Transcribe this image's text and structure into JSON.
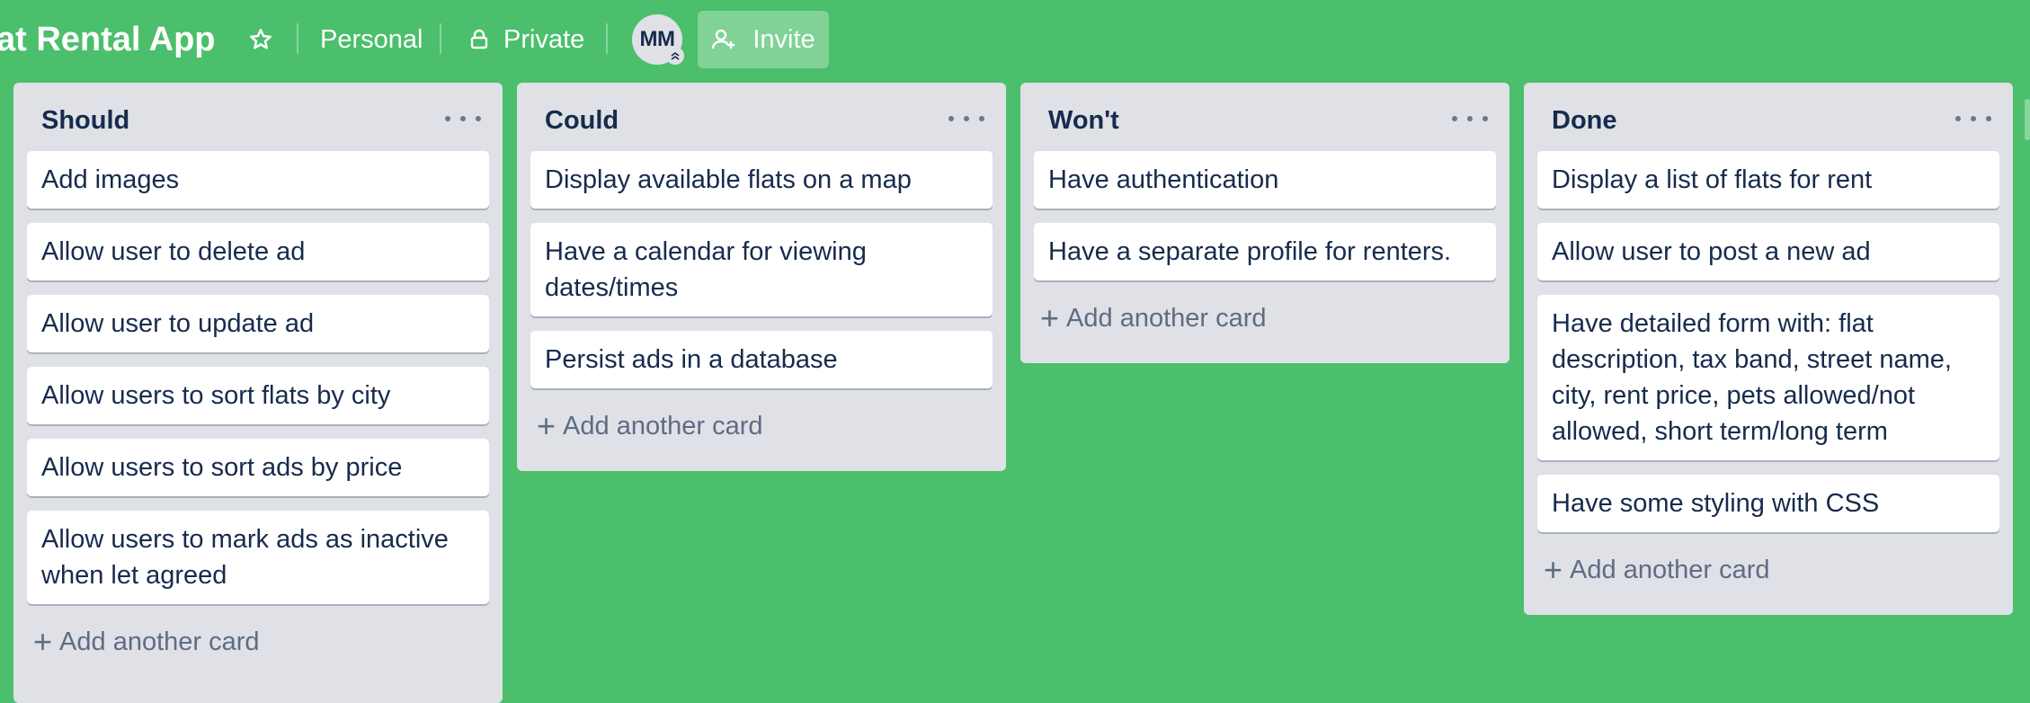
{
  "header": {
    "board_title": "at Rental App",
    "star_icon": "star-outline-icon",
    "workspace_label": "Personal",
    "visibility_label": "Private",
    "avatar_initials": "MM",
    "invite_label": "Invite"
  },
  "lists": [
    {
      "title": "Should",
      "cards": [
        "Add images",
        "Allow user to delete ad",
        "Allow user to update ad",
        "Allow users to sort flats by city",
        "Allow users to sort ads by price",
        "Allow users to mark ads as inactive when let agreed"
      ],
      "add_label": "Add another card"
    },
    {
      "title": "Could",
      "cards": [
        "Display available flats on a map",
        "Have a calendar for viewing dates/times",
        "Persist ads in a database"
      ],
      "add_label": "Add another card"
    },
    {
      "title": "Won't",
      "cards": [
        "Have authentication",
        "Have a separate profile for renters."
      ],
      "add_label": "Add another card"
    },
    {
      "title": "Done",
      "cards": [
        "Display a list of flats for rent",
        "Allow user to post a new ad",
        "Have detailed form with: flat description, tax band, street name, city, rent price, pets allowed/not allowed, short term/long term",
        "Have some styling with CSS"
      ],
      "add_label": "Add another card"
    }
  ],
  "colors": {
    "board_background": "#4bbf6b",
    "list_background": "#dfe1e6",
    "text": "#172b4d"
  }
}
